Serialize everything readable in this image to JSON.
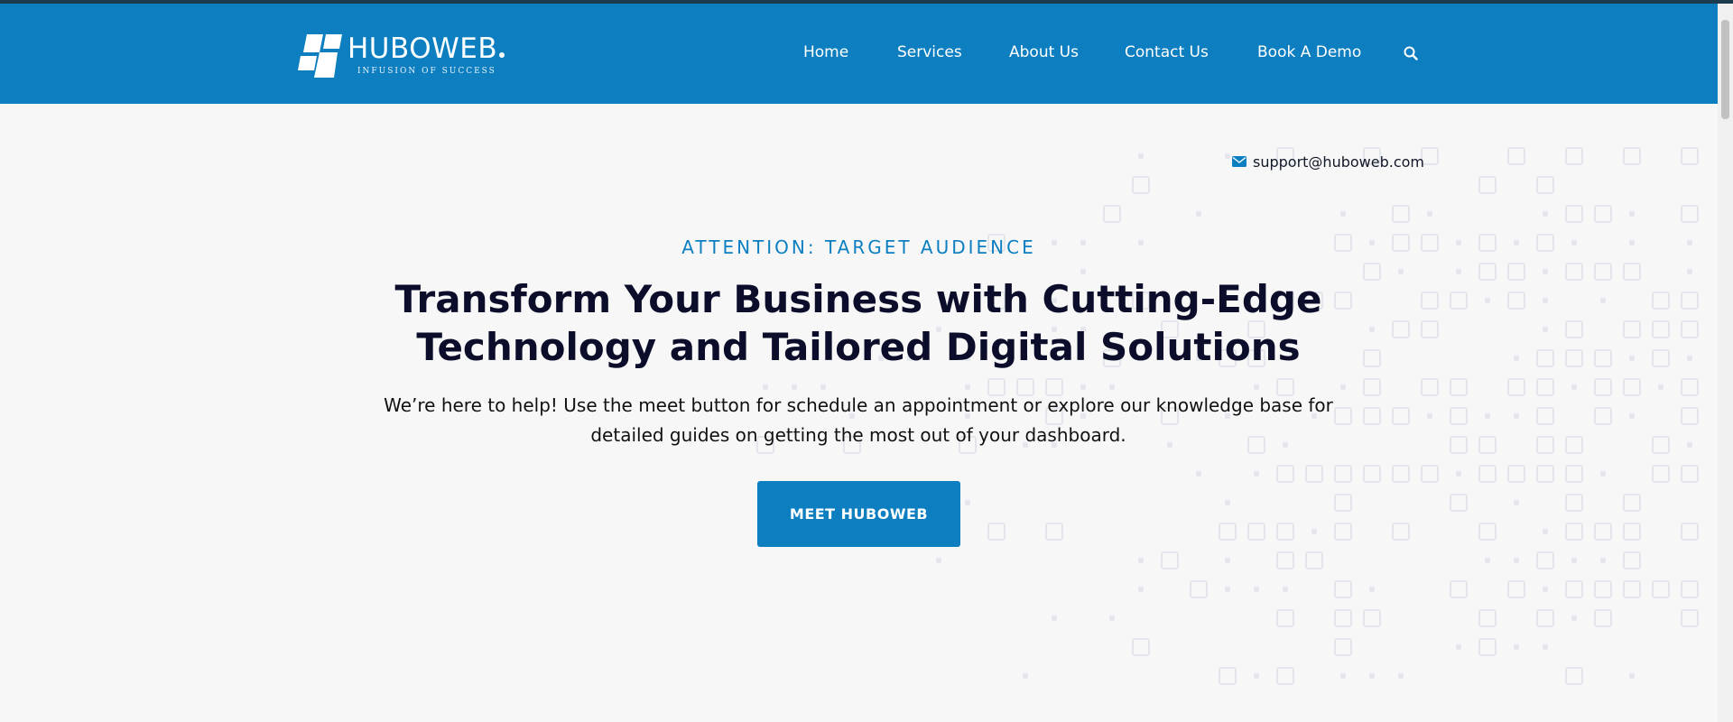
{
  "header": {
    "logo": {
      "name": "HUBOWEB",
      "tagline": "INFUSION OF SUCCESS",
      "icon": "huboweb-logo-mark"
    },
    "nav": [
      {
        "label": "Home"
      },
      {
        "label": "Services"
      },
      {
        "label": "About Us"
      },
      {
        "label": "Contact Us"
      },
      {
        "label": "Book A Demo"
      }
    ],
    "search_icon": "search-icon",
    "background_color": "#0d7fc1"
  },
  "contact": {
    "icon": "mail-icon",
    "email": "support@huboweb.com"
  },
  "hero": {
    "eyebrow": "ATTENTION: TARGET AUDIENCE",
    "headline_line1": "Transform Your Business with Cutting-Edge",
    "headline_line2": "Technology and Tailored Digital Solutions",
    "subtext_line1": "We’re here to help! Use the meet button for schedule an appointment or explore our knowledge base for",
    "subtext_line2": "detailed guides on getting the most out of your dashboard.",
    "cta_label": "MEET HUBOWEB"
  },
  "colors": {
    "brand_blue": "#0d7fc1",
    "headline": "#0b0d2a",
    "page_background": "#f7f7f7"
  }
}
